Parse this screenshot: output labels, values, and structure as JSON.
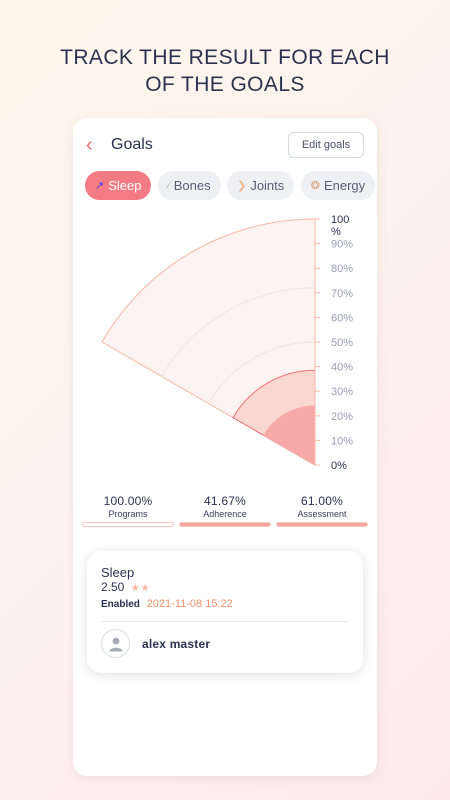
{
  "headline": {
    "line1": "TRACK THE RESULT FOR EACH",
    "line2": "OF THE GOALS"
  },
  "header": {
    "back_icon": "chevron-left-icon",
    "title": "Goals",
    "edit_label": "Edit goals"
  },
  "tabs": [
    {
      "label": "Sleep",
      "icon": "sleep-icon",
      "active": true
    },
    {
      "label": "Bones",
      "icon": "bone-icon",
      "active": false
    },
    {
      "label": "Joints",
      "icon": "joint-icon",
      "active": false
    },
    {
      "label": "Energy",
      "icon": "energy-icon",
      "active": false
    }
  ],
  "chart_data": {
    "type": "polar-sector",
    "scale_ticks": [
      "0%",
      "10%",
      "20%",
      "30%",
      "40%",
      "50%",
      "60%",
      "70%",
      "80%",
      "90%",
      "100\n%"
    ],
    "ylim": [
      0,
      100
    ],
    "series": [
      {
        "value": 100.0,
        "color": "#f6b5a2"
      },
      {
        "value": 61.0,
        "color": "#f08c8c"
      },
      {
        "value": 41.67,
        "color": "#f7b3b0"
      }
    ]
  },
  "stats": [
    {
      "value": "100.00%",
      "label": "Programs",
      "fill": 0
    },
    {
      "value": "41.67%",
      "label": "Adherence",
      "fill": 100
    },
    {
      "value": "61.00%",
      "label": "Assessment",
      "fill": 100
    }
  ],
  "card": {
    "title": "Sleep",
    "rating": "2.50",
    "stars": "★★",
    "status": "Enabled",
    "timestamp": "2021-11-08 15:22",
    "user_name": "alex master",
    "avatar_icon": "user-icon"
  },
  "colors": {
    "accent": "#f37b83",
    "text": "#2b3150",
    "timestamp": "#f2926a"
  }
}
